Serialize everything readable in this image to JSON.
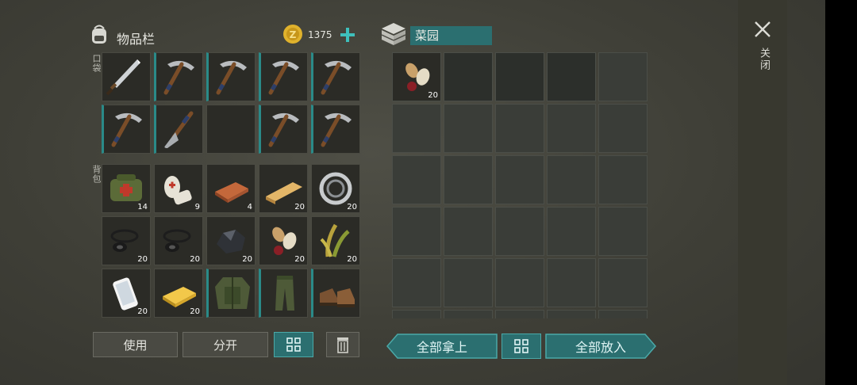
{
  "inventory": {
    "title": "物品栏",
    "pocket_label": "口袋",
    "backpack_label": "背包",
    "coins": "1375",
    "pocket": [
      {
        "icon": "sword-icon",
        "count": ""
      },
      {
        "icon": "pickaxe-icon",
        "count": ""
      },
      {
        "icon": "pickaxe-icon",
        "count": ""
      },
      {
        "icon": "pickaxe-icon",
        "count": ""
      },
      {
        "icon": "pickaxe-icon",
        "count": ""
      },
      {
        "icon": "pickaxe-icon",
        "count": ""
      },
      {
        "icon": "shovel-icon",
        "count": ""
      },
      {
        "icon": "",
        "count": ""
      },
      {
        "icon": "pickaxe-icon",
        "count": ""
      },
      {
        "icon": "pickaxe-icon",
        "count": ""
      }
    ],
    "backpack": [
      {
        "icon": "medkit-bag-icon",
        "count": "14"
      },
      {
        "icon": "bandage-icon",
        "count": "9"
      },
      {
        "icon": "copper-ingot-icon",
        "count": "4"
      },
      {
        "icon": "wood-plank-icon",
        "count": "20"
      },
      {
        "icon": "bearing-icon",
        "count": "20"
      },
      {
        "icon": "rubber-rings-icon",
        "count": "20"
      },
      {
        "icon": "rubber-rings-icon",
        "count": "20"
      },
      {
        "icon": "coal-ore-icon",
        "count": "20"
      },
      {
        "icon": "seeds-icon",
        "count": "20"
      },
      {
        "icon": "plant-fiber-icon",
        "count": "20"
      },
      {
        "icon": "smartphone-icon",
        "count": "20"
      },
      {
        "icon": "gold-ingot-icon",
        "count": "20"
      },
      {
        "icon": "jacket-icon",
        "count": ""
      },
      {
        "icon": "pants-icon",
        "count": ""
      },
      {
        "icon": "boots-icon",
        "count": ""
      }
    ],
    "buttons": {
      "use": "使用",
      "split": "分开"
    }
  },
  "garden": {
    "title": "菜园",
    "slot0_count": "20",
    "take_all": "全部拿上",
    "put_all": "全部放入"
  },
  "close_label": "关闭",
  "colors": {
    "accent": "#2b6f70",
    "accent_light": "#4aa9a8",
    "coin": "#e0b22c"
  }
}
